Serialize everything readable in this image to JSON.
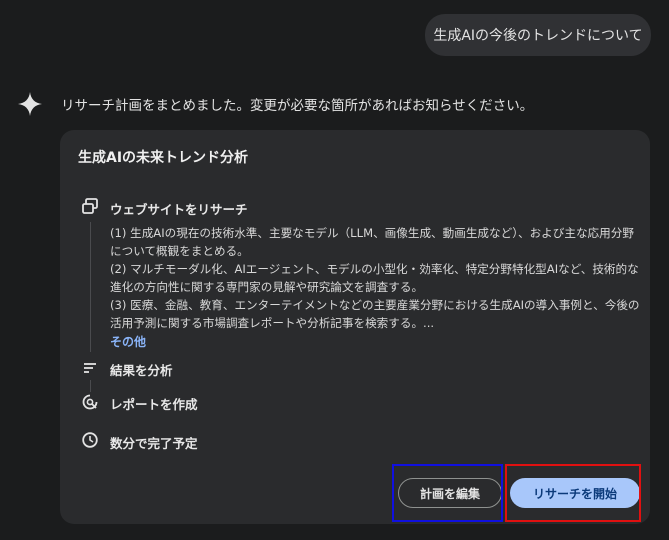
{
  "user_message": "生成AIの今後のトレンドについて",
  "assistant_intro": "リサーチ計画をまとめました。変更が必要な箇所があればお知らせください。",
  "plan": {
    "title": "生成AIの未来トレンド分析",
    "steps": [
      {
        "label": "ウェブサイトをリサーチ",
        "icon": "browse-icon"
      },
      {
        "label": "結果を分析",
        "icon": "analyze-icon"
      },
      {
        "label": "レポートを作成",
        "icon": "report-icon"
      },
      {
        "label": "数分で完了予定",
        "icon": "clock-icon"
      }
    ],
    "research_items": [
      "(1) 生成AIの現在の技術水準、主要なモデル（LLM、画像生成、動画生成など）、および主な応用分野について概観をまとめる。",
      "(2) マルチモーダル化、AIエージェント、モデルの小型化・効率化、特定分野特化型AIなど、技術的な進化の方向性に関する専門家の見解や研究論文を調査する。",
      "(3) 医療、金融、教育、エンターテイメントなどの主要産業分野における生成AIの導入事例と、今後の活用予測に関する市場調査レポートや分析記事を検索する。..."
    ],
    "more_link": "その他"
  },
  "actions": {
    "edit_label": "計画を編集",
    "start_label": "リサーチを開始"
  },
  "colors": {
    "background": "#1b1c1d",
    "card": "#2a2b2d",
    "primary_button": "#a8c7fa",
    "link": "#8ab4f8",
    "highlight_blue": "#1010e0",
    "highlight_red": "#e01010"
  }
}
